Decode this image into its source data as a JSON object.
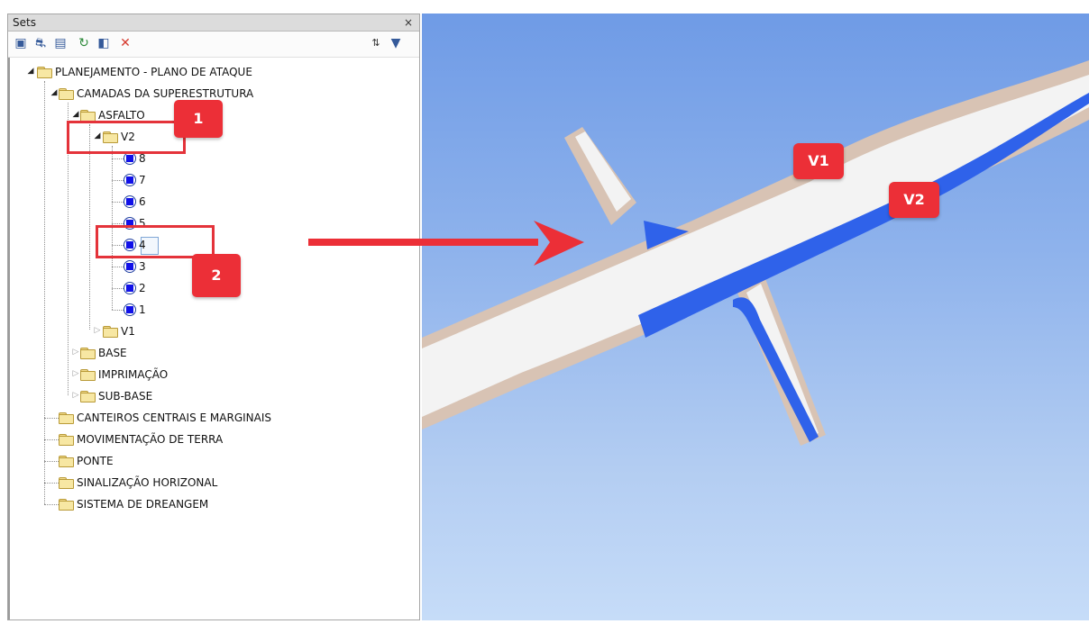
{
  "panel": {
    "title": "Sets",
    "close_symbol": "×",
    "toolbar": {
      "icons": [
        "save-selection-icon",
        "find-items-icon",
        "save-search-icon",
        "add-comment-icon",
        "import-export-icon",
        "delete-icon",
        "sort-icon",
        "options-icon"
      ]
    }
  },
  "tree": {
    "root": "PLANEJAMENTO - PLANO DE ATAQUE",
    "l1_camadas": "CAMADAS DA SUPERESTRUTURA",
    "l2_asfalto": "ASFALTO",
    "l3_v2": "V2",
    "sets_v2": [
      "8",
      "7",
      "6",
      "5",
      "4",
      "3",
      "2",
      "1"
    ],
    "l3_v1": "V1",
    "l2_base": "BASE",
    "l2_imprimacao": "IMPRIMAÇÃO",
    "l2_subbase": "SUB-BASE",
    "l1_canteiros": "CANTEIROS CENTRAIS E MARGINAIS",
    "l1_movimentacao": "MOVIMENTAÇÃO DE TERRA",
    "l1_ponte": "PONTE",
    "l1_sinalizacao": "SINALIZAÇÃO HORIZONAL",
    "l1_drenagem": "SISTEMA DE DREANGEM"
  },
  "annotations": {
    "badge1": "1",
    "badge2": "2",
    "badge_v1": "V1",
    "badge_v2": "V2"
  },
  "colors": {
    "annotation_red": "#ec2f37",
    "highlight_blue": "#2f62ea",
    "road_surface": "#f2f2f2",
    "shoulder": "#d8c3b4",
    "sky_top": "#6f9be6",
    "sky_bottom": "#c6dcf8"
  }
}
